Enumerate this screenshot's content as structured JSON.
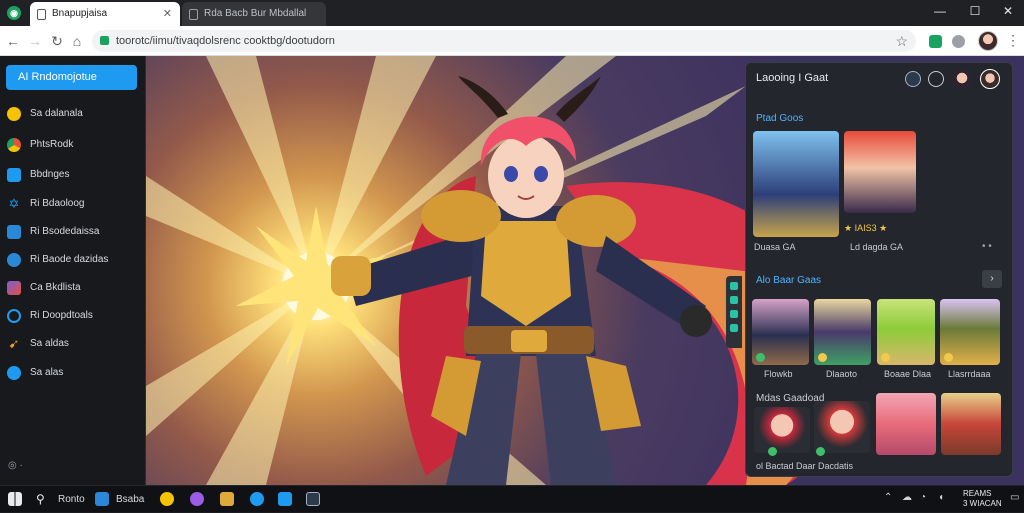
{
  "browser": {
    "tabs": [
      {
        "title": "Bnapupjaisa",
        "active": true
      },
      {
        "title": "Rda Bacb Bur Mbdallal",
        "active": false
      }
    ],
    "url": "toorotc/iimu/tivaqdolsrenc cooktbg/dootudorn",
    "window_controls": [
      "—",
      "☐",
      "✕"
    ],
    "accent": "#1aa260"
  },
  "sidebar": {
    "new_button": "AI Rndomojotue",
    "items": [
      {
        "label": "Sa dalanala",
        "icon": "sun-icon",
        "color": "#f5c400"
      },
      {
        "label": "PhtsRodk",
        "icon": "chrome-icon",
        "color": "#e5533d"
      },
      {
        "label": "Bbdnges",
        "icon": "skype-icon",
        "color": "#1e9bf0"
      },
      {
        "label": "Ri Bdaoloog",
        "icon": "star-icon",
        "color": "#1e9bf0"
      },
      {
        "label": "Ri Bsodedaissa",
        "icon": "briefcase-icon",
        "color": "#2b88d8"
      },
      {
        "label": "Ri Baode dazidas",
        "icon": "globe-icon",
        "color": "#2b88d8"
      },
      {
        "label": "Ca Bkdlista",
        "icon": "gallery-icon",
        "color": "#7b5cd6"
      },
      {
        "label": "Ri Doopdtoals",
        "icon": "refresh-icon",
        "color": "#1e9bf0"
      },
      {
        "label": "Sa aldas",
        "icon": "pin-icon",
        "color": "#f0a020"
      },
      {
        "label": "Sa alas",
        "icon": "info-icon",
        "color": "#1e9bf0"
      }
    ],
    "footer": "◎ ·"
  },
  "panel": {
    "title": "Laooing I Gaat",
    "section1": {
      "heading": "Ptad Goos",
      "cards": [
        {
          "caption": "Duasa GA"
        },
        {
          "caption": "Ld dagda GA"
        }
      ],
      "rating": "★ IAIS3 ★"
    },
    "section2": {
      "heading": "Alo Baar Gaas",
      "arrow": "›",
      "cards": [
        {
          "caption": "Flowkb"
        },
        {
          "caption": "Dlaaoto"
        },
        {
          "caption": "Boaae Dlaa"
        },
        {
          "caption": "Llasrrdaaa"
        }
      ]
    },
    "section3": {
      "heading": "Mdas Gaadoad",
      "caption": "ol Bactad Daar Dacdatis"
    }
  },
  "taskbar": {
    "search": "Ronto",
    "app_label": "Bsaba",
    "tray_text_top": "REAMS",
    "tray_text_bottom": "3 WIACAN"
  }
}
